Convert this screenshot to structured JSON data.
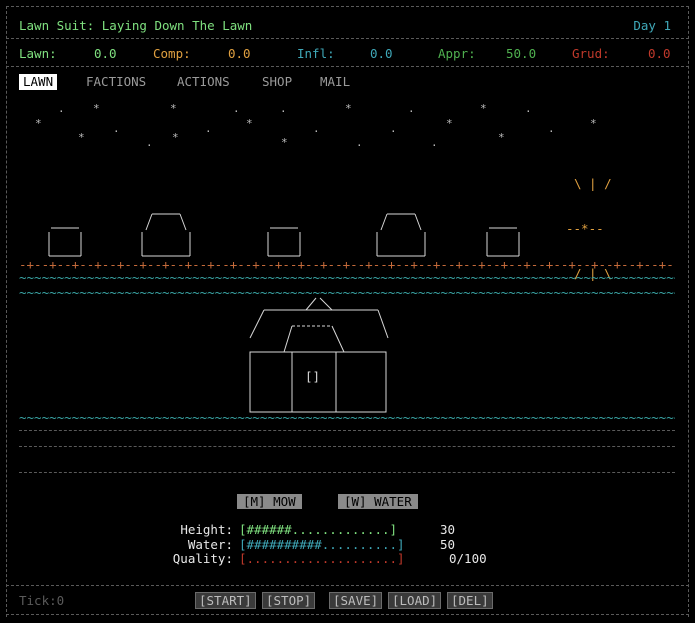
{
  "header": {
    "title": "Lawn Suit: Laying Down The Lawn",
    "day": "Day 1"
  },
  "stats": [
    {
      "label": "Lawn:",
      "value": "0.0",
      "label_color": "#7fe07f",
      "value_color": "#7fe07f"
    },
    {
      "label": "Comp:",
      "value": "0.0",
      "label_color": "#e0a040",
      "value_color": "#e0a040"
    },
    {
      "label": "Infl:",
      "value": "0.0",
      "label_color": "#3fa8b8",
      "value_color": "#3fa8b8"
    },
    {
      "label": "Appr:",
      "value": "50.0",
      "label_color": "#4fb04f",
      "value_color": "#4fb04f"
    },
    {
      "label": "Grud:",
      "value": "0.0",
      "label_color": "#c0392b",
      "value_color": "#c0392b"
    }
  ],
  "tabs": [
    {
      "label": "LAWN",
      "active": true
    },
    {
      "label": "FACTIONS",
      "active": false
    },
    {
      "label": "ACTIONS",
      "active": false
    },
    {
      "label": "SHOP",
      "active": false
    },
    {
      "label": "MAIL",
      "active": false
    }
  ],
  "scene": {
    "sun": [
      "\\ | /",
      "--*--",
      "/ | \\"
    ],
    "fence": "-+--+--+--+--+--+--+--+--+--+--+--+--+--+--+--+--+--+--+--+--+--+--+--+--+--+--+--+--+--+--+--+--+-",
    "grass": "~~~~~~~~~~~~~~~~~~~~~~~~~~~~~~~~~~~~~~~~~~~~~~~~~~~~~~~~~~~~~~~~~~~~~~~~~~~~~~~~~~~~~~~~~~~~~~~~~~~~~~~~~~~~~~~~~~~~~~~~~~~~~~",
    "house": "          /\\\n  _______/  \\______\n /                 \\\n/    .----.        \\\n/___/      \\_______ \\\n|   |      |       |\n|   |  []  |       |\n|   |      |       |\n|___|______|_______|",
    "door_glyph": "[]"
  },
  "actions": {
    "mow": "[M] MOW",
    "water": "[W] WATER"
  },
  "meters": [
    {
      "label": "Height:",
      "bar": "[######.............]",
      "value": "30",
      "color": "#7fe07f"
    },
    {
      "label": "Water:",
      "bar": "[##########..........]",
      "value": "50",
      "color": "#3fa8b8"
    },
    {
      "label": "Quality:",
      "bar": "[....................]",
      "value": "0/100",
      "color": "#c0392b"
    }
  ],
  "footer": {
    "tick": "Tick:0",
    "buttons": [
      "[START]",
      "[STOP]",
      "[SAVE]",
      "[LOAD]",
      "[DEL]"
    ]
  }
}
